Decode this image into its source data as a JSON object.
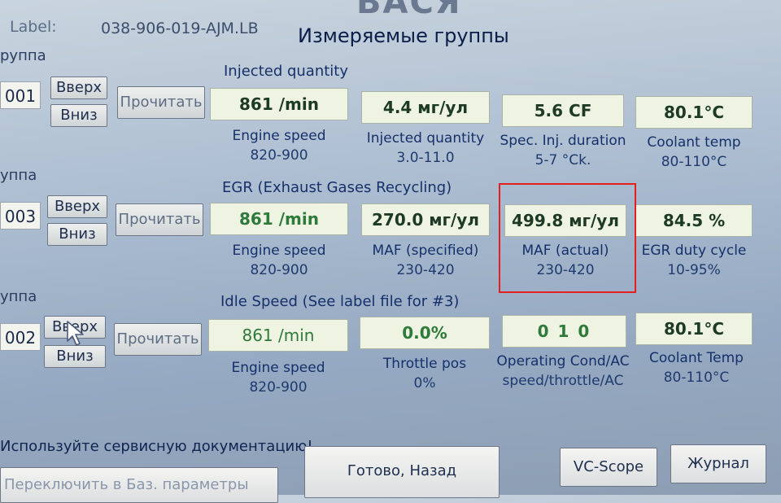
{
  "header": {
    "top_title": "ВАСЯ",
    "label_caption": "Label:",
    "label_value": "038-906-019-AJM.LB",
    "window_title": "Измеряемые группы"
  },
  "groups": [
    {
      "caption": "руппа",
      "number": "001",
      "up_label": "Вверх",
      "down_label": "Вниз",
      "read_label": "Прочитать",
      "title": "Injected quantity",
      "cells": [
        {
          "value": "861 /min",
          "name": "Engine speed",
          "range": "820-900"
        },
        {
          "value": "4.4 мг/ул",
          "name": "Injected quantity",
          "range": "3.0-11.0"
        },
        {
          "value": "5.6 CF",
          "name": "Spec. Inj. duration",
          "range": "5-7 °Ck."
        },
        {
          "value": "80.1°C",
          "name": "Coolant temp",
          "range": "80-110°C"
        }
      ]
    },
    {
      "caption": "уппа",
      "number": "003",
      "up_label": "Вверх",
      "down_label": "Вниз",
      "read_label": "Прочитать",
      "title": "EGR (Exhaust Gases Recycling)",
      "cells": [
        {
          "value": "861 /min",
          "name": "Engine speed",
          "range": "820-900"
        },
        {
          "value": "270.0 мг/ул",
          "name": "MAF (specified)",
          "range": "230-420"
        },
        {
          "value": "499.8 мг/ул",
          "name": "MAF (actual)",
          "range": "230-420"
        },
        {
          "value": "84.5 %",
          "name": "EGR duty cycle",
          "range": "10-95%"
        }
      ]
    },
    {
      "caption": "уппа",
      "number": "002",
      "up_label": "Вверх",
      "down_label": "Вниз",
      "read_label": "Прочитать",
      "title": "Idle Speed (See label file for #3)",
      "cells": [
        {
          "value": "861 /min",
          "name": "Engine speed",
          "range": "820-900"
        },
        {
          "value": "0.0%",
          "name": "Throttle pos",
          "range": "0%"
        },
        {
          "value": "0  1  0",
          "name": "Operating Cond/AC",
          "range": "speed/throttle/AC"
        },
        {
          "value": "80.1°C",
          "name": "Coolant Temp",
          "range": "80-110°C"
        }
      ]
    }
  ],
  "footer": {
    "notice": "Используйте сервисную документацию!",
    "switch_label": "Переключить в Баз. параметры",
    "done_label": "Готово, Назад",
    "scope_label": "VC-Scope",
    "log_label": "Журнал"
  }
}
